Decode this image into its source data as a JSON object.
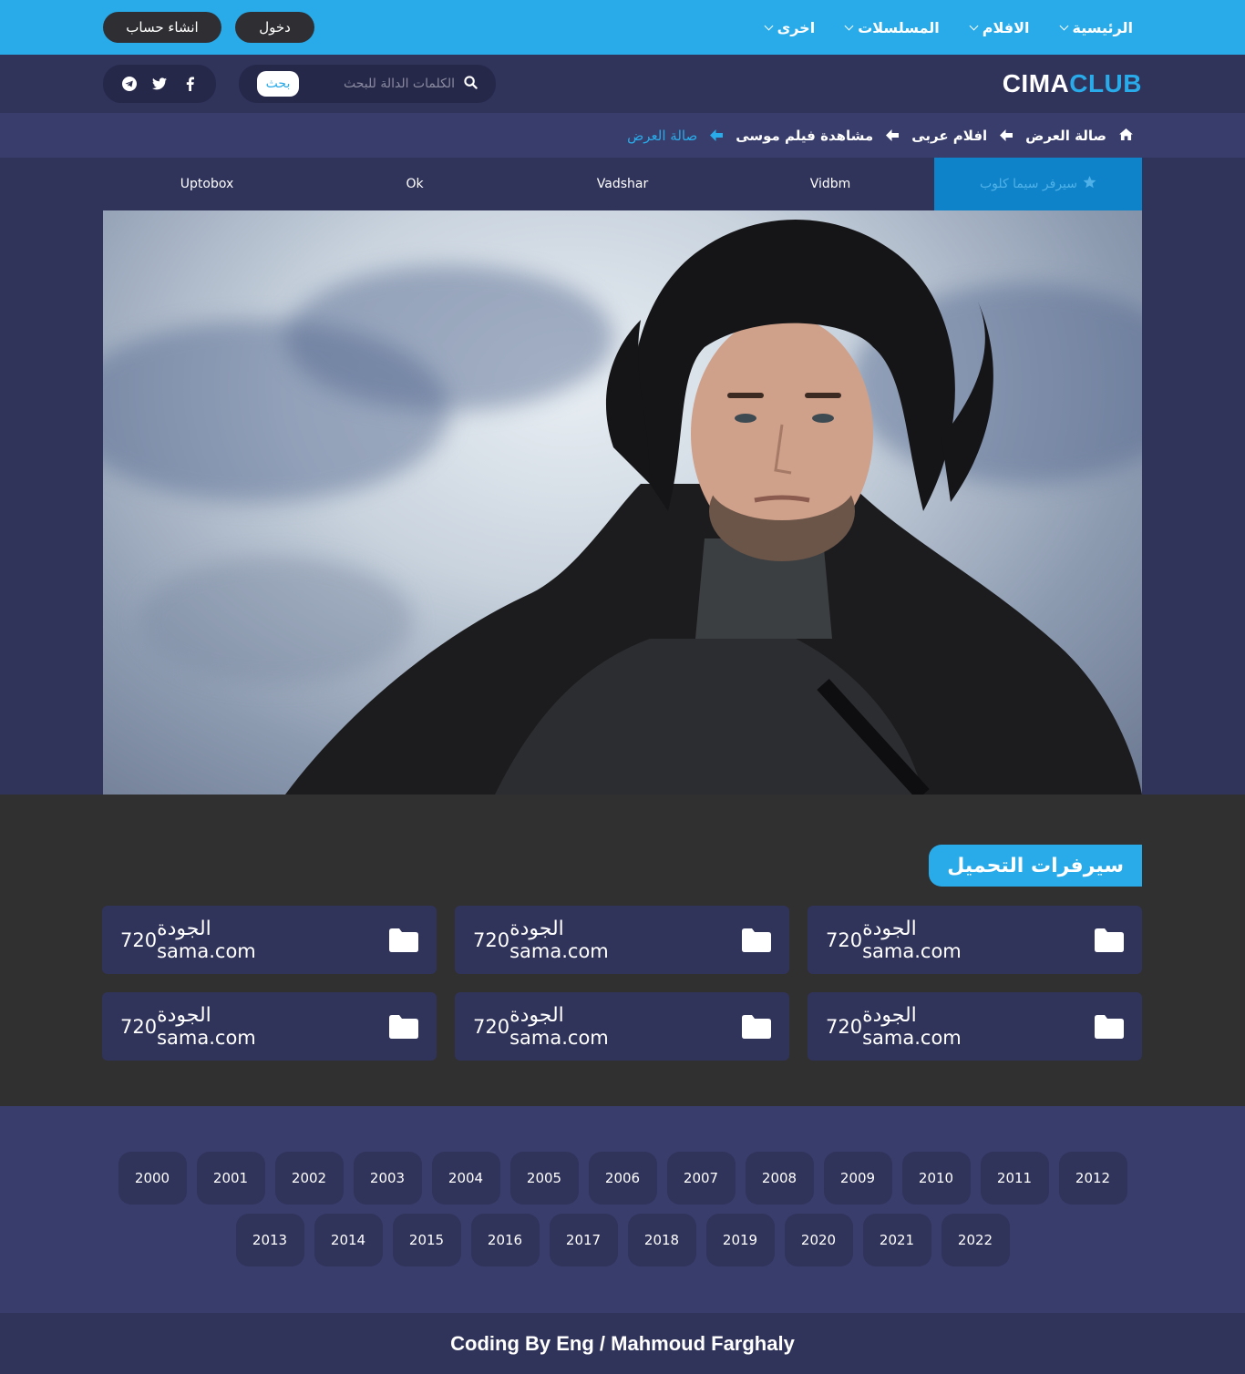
{
  "topbar": {
    "menu": [
      {
        "label": "الرئيسية"
      },
      {
        "label": "الافلام"
      },
      {
        "label": "المسلسلات"
      },
      {
        "label": "اخرى"
      }
    ],
    "register_label": "انشاء حساب",
    "login_label": "دخول"
  },
  "header": {
    "logo_part1": "CIMA",
    "logo_part2": "CLUB",
    "search_placeholder": "الكلمات الدالة للبحث",
    "search_button": "بحث",
    "social_icons": [
      "facebook-icon",
      "twitter-icon",
      "telegram-icon"
    ]
  },
  "breadcrumb": {
    "items": [
      "صالة العرض",
      "افلام عربى",
      "مشاهدة فيلم موسى",
      "صالة العرض"
    ]
  },
  "servers": {
    "tabs": [
      "سيرفر سيما كلوب",
      "Vidbm",
      "Vadshar",
      "Ok",
      "Uptobox"
    ]
  },
  "downloads": {
    "title": "سيرفرات التحميل",
    "cards": [
      {
        "quality_label": "الجودة",
        "host": "sama.com",
        "resolution": "720"
      },
      {
        "quality_label": "الجودة",
        "host": "sama.com",
        "resolution": "720"
      },
      {
        "quality_label": "الجودة",
        "host": "sama.com",
        "resolution": "720"
      },
      {
        "quality_label": "الجودة",
        "host": "sama.com",
        "resolution": "720"
      },
      {
        "quality_label": "الجودة",
        "host": "sama.com",
        "resolution": "720"
      },
      {
        "quality_label": "الجودة",
        "host": "sama.com",
        "resolution": "720"
      }
    ]
  },
  "years": {
    "row1": [
      "2000",
      "2001",
      "2002",
      "2003",
      "2004",
      "2005",
      "2006",
      "2007",
      "2008",
      "2009",
      "2010",
      "2011",
      "2012"
    ],
    "row2": [
      "2013",
      "2014",
      "2015",
      "2016",
      "2017",
      "2018",
      "2019",
      "2020",
      "2021",
      "2022"
    ]
  },
  "footer": {
    "credit": "Coding By Eng / Mahmoud Farghaly"
  },
  "colors": {
    "accent": "#29aae9",
    "navy": "#30335a",
    "dark": "#303030"
  }
}
